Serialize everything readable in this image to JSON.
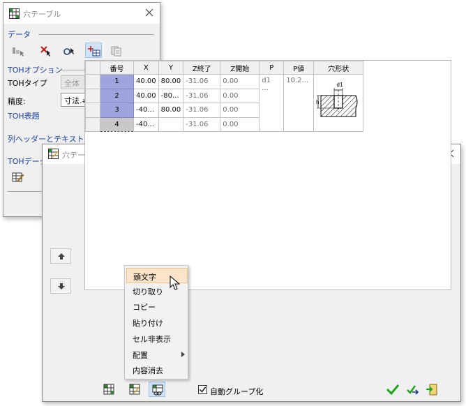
{
  "panel": {
    "title": "穴テーブル",
    "data_section": "データ",
    "toh_option_section": "TOHオプション",
    "toh_type_label": "TOHタイプ",
    "toh_type_value": "全体",
    "precision_label": "精度:",
    "precision_value": "寸法.##",
    "toh_header_section": "TOH表題",
    "column_header_section": "列ヘッダーとテキストスタイル",
    "toh_data_section": "TOHデータI"
  },
  "editor": {
    "title": "穴テーブルエディタ",
    "columns": [
      "番号",
      "X",
      "Y",
      "Z終了",
      "Z開始",
      "P",
      "P値",
      "穴形状"
    ],
    "rows": [
      {
        "num": "1",
        "x": "40.00",
        "y": "80.00",
        "zend": "-31.06",
        "zstart": "0.00"
      },
      {
        "num": "2",
        "x": "40.00",
        "y": "-80...",
        "zend": "-31.06",
        "zstart": "0.00"
      },
      {
        "num": "3",
        "x": "-40...",
        "y": "80.00",
        "zend": "-31.06",
        "zstart": "0.00"
      },
      {
        "num": "4",
        "x": "-40...",
        "y": "",
        "zend": "-31.06",
        "zstart": "0.00"
      }
    ],
    "p_value": "d1",
    "p_more": "...",
    "pval_value": "10.2...",
    "shape_d_label": "d1",
    "shape_h_label": "h",
    "auto_group_label": "自動グループ化",
    "auto_group_checked": true
  },
  "context_menu": {
    "items": [
      "頭文字",
      "切り取り",
      "コピー",
      "貼り付け",
      "セル非表示",
      "配置",
      "内容消去"
    ],
    "highlighted": "頭文字",
    "submenu_item": "配置"
  },
  "colors": {
    "section_title": "#1b3f9c",
    "number_cell": "#9ea5dd",
    "menu_highlight": "#fbe4c9",
    "ok_green": "#1aa81a"
  },
  "icons": {
    "panel_title": "hole-table-icon",
    "editor_title": "hole-table-edit-icon",
    "close": "close-icon"
  }
}
